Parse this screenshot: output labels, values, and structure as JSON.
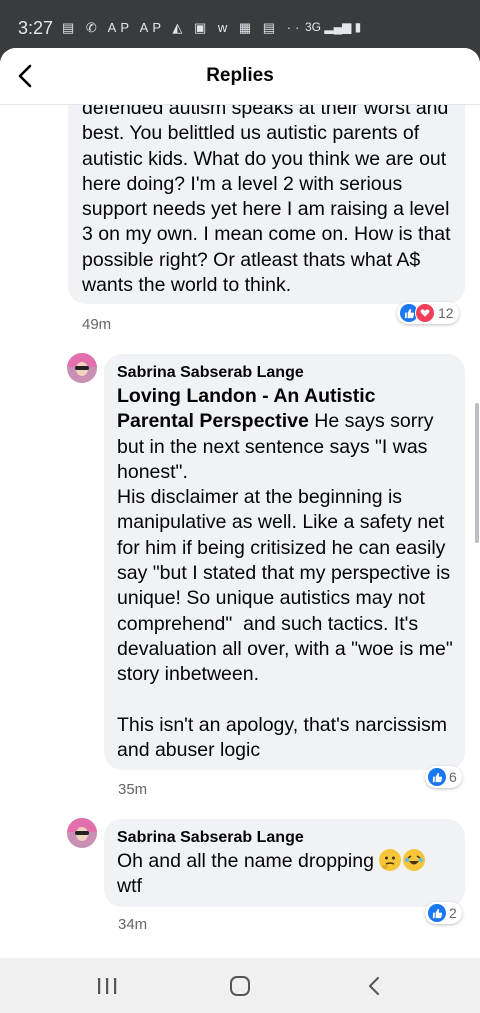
{
  "status": {
    "time": "3:27",
    "icons": [
      "notification-icon",
      "whatsapp-icon",
      "ap-icon",
      "ap-icon",
      "gallery-icon",
      "news-icon",
      "w-icon",
      "image-icon",
      "calendar-icon",
      "more-dots-icon"
    ],
    "icon_text": "▤ ✆ AP AP ◭ ▣ w ▦ ▤ ··",
    "network": "3G ▂▄▆ ▮"
  },
  "header": {
    "title": "Replies"
  },
  "comments": [
    {
      "text": "defended autism speaks at their worst and best. You belittled us autistic parents of autistic kids. What do you think we are out here doing? I'm a level 2 with serious support needs yet here I am raising a level 3 on my own. I mean come on. How is that possible right? Or atleast thats what A$ wants the world to think.",
      "time": "49m",
      "reaction_count": "12"
    },
    {
      "author": "Sabrina Sabserab Lange",
      "mention": "Loving Landon - An Autistic Parental Perspective",
      "text": " He says sorry but in the next sentence says \"I was honest\".\nHis disclaimer at the beginning is manipulative as well. Like a safety net for him if being critisized he can easily say \"but I stated that my perspective is unique! So unique autistics may not comprehend\"  and such tactics. It's devaluation all over, with a \"woe is me\" story inbetween.\n\nThis isn't an apology, that's narcissism and abuser logic",
      "time": "35m",
      "reaction_count": "6"
    },
    {
      "author": "Sabrina Sabserab Lange",
      "text": "Oh and all the name dropping",
      "text2": "wtf",
      "time": "34m",
      "reaction_count": "2"
    }
  ],
  "colors": {
    "like": "#1877f2",
    "heart": "#f33e58",
    "bubble": "#f0f2f5"
  }
}
